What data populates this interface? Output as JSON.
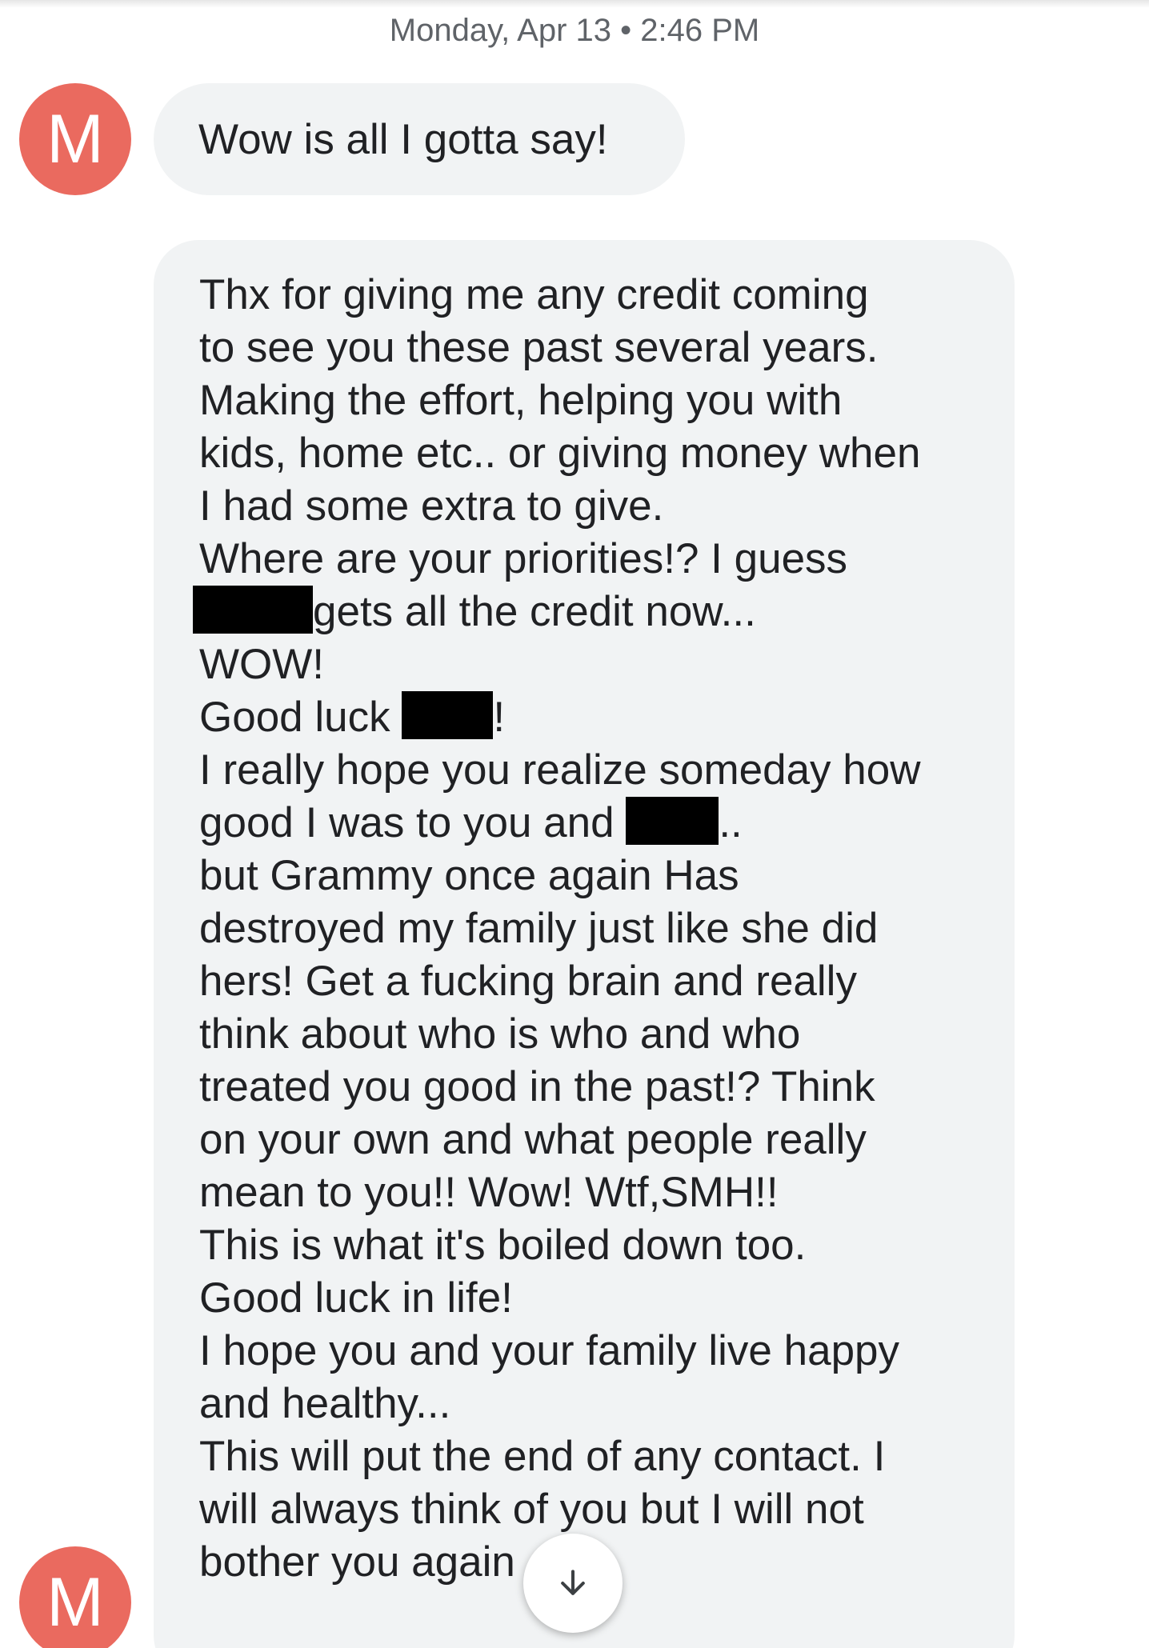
{
  "conversation": {
    "timestamp": "Monday, Apr 13 • 2:46 PM",
    "contact_initial": "M",
    "messages": [
      {
        "text": "Wow is all I gotta say!"
      }
    ],
    "long_message": {
      "lines": [
        "Thx for giving me any credit coming",
        "to see you these past several years.",
        "Making the effort, helping you with",
        "kids, home etc.. or giving money when",
        "I had some extra to give.",
        "Where are your priorities!? I guess",
        "gets all the credit now...",
        "WOW!",
        "Good luck",
        "!",
        "I really hope you realize someday how",
        "good I was to you and",
        "..",
        "but Grammy once again Has",
        "destroyed my family just like she did",
        "hers! Get a fucking brain and really",
        "think about who is who and who",
        "treated you good in the past!?  Think",
        "on your own and what people really",
        "mean to you!!  Wow! Wtf,SMH!!",
        "This is what it's boiled down too.",
        "Good luck in life!",
        "I hope you and your family live happy",
        "and healthy...",
        "This will put the end of any contact. I",
        "will always think of you but I will not",
        "bother you again"
      ]
    }
  },
  "scroll_button": {
    "icon": "arrow-down-icon"
  },
  "colors": {
    "avatar_bg": "#ea6a5f",
    "bubble_bg": "#f1f3f4",
    "text": "#202124",
    "timestamp_text": "#5f6368"
  }
}
